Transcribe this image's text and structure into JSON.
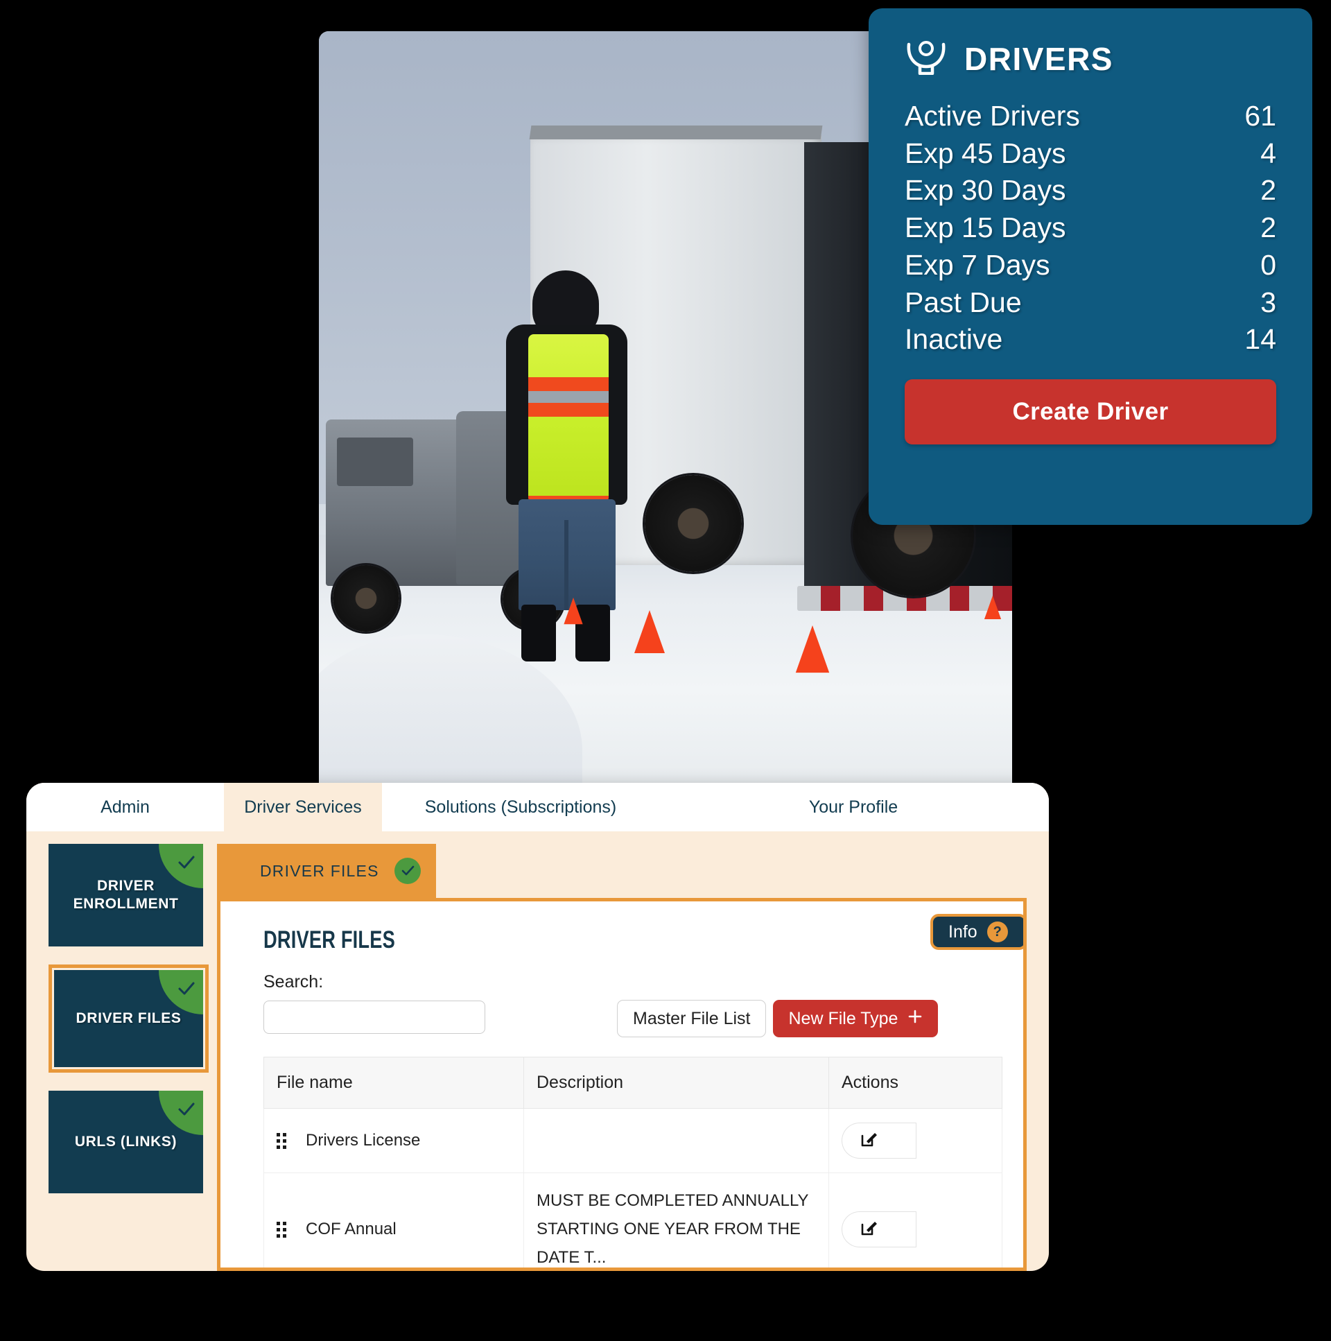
{
  "drivers_card": {
    "icon": "driver-person-icon",
    "title": "DRIVERS",
    "accent_color": "#0f5a80",
    "button_color": "#c7332d",
    "stats": [
      {
        "label": "Active Drivers",
        "value": "61"
      },
      {
        "label": "Exp 45 Days",
        "value": "4"
      },
      {
        "label": "Exp 30 Days",
        "value": "2"
      },
      {
        "label": "Exp 15 Days",
        "value": "2"
      },
      {
        "label": "Exp 7 Days",
        "value": "0"
      },
      {
        "label": "Past Due",
        "value": "3"
      },
      {
        "label": "Inactive",
        "value": "14"
      }
    ],
    "create_button": "Create Driver"
  },
  "photo": {
    "alt": "Worker in high-visibility vest standing in snow behind a box truck"
  },
  "panel": {
    "tabs": [
      {
        "label": "Admin",
        "active": false
      },
      {
        "label": "Driver Services",
        "active": true
      },
      {
        "label": "Solutions (Subscriptions)",
        "active": false
      },
      {
        "label": "Your Profile",
        "active": false
      }
    ],
    "sidebar": [
      {
        "label": "DRIVER ENROLLMENT",
        "complete": true,
        "selected": false
      },
      {
        "label": "DRIVER FILES",
        "complete": true,
        "selected": true
      },
      {
        "label": "URLS (LINKS)",
        "complete": true,
        "selected": false
      }
    ],
    "file_tab": {
      "label": "DRIVER FILES",
      "complete": true
    },
    "content": {
      "heading": "DRIVER FILES",
      "info_badge": {
        "label": "Info",
        "icon": "question-mark-icon"
      },
      "search_label": "Search:",
      "search_value": "",
      "search_placeholder": "",
      "buttons": {
        "master_file_list": "Master File List",
        "new_file_type": "New File Type",
        "new_file_type_icon": "plus-icon"
      },
      "table": {
        "columns": [
          "File name",
          "Description",
          "Actions"
        ],
        "rows": [
          {
            "name": "Drivers License",
            "description": "",
            "drag_icon": "drag-handle-icon",
            "edit_icon": "edit-pencil-icon"
          },
          {
            "name": "COF Annual",
            "description": "MUST BE COMPLETED ANNUALLY STARTING ONE YEAR FROM THE DATE T...",
            "drag_icon": "drag-handle-icon",
            "edit_icon": "edit-pencil-icon"
          }
        ]
      }
    }
  },
  "colors": {
    "navy": "#123c50",
    "teal": "#0f5a80",
    "orange": "#e8983a",
    "cream": "#fbecda",
    "green": "#4c9a3f",
    "red": "#c7332d"
  }
}
